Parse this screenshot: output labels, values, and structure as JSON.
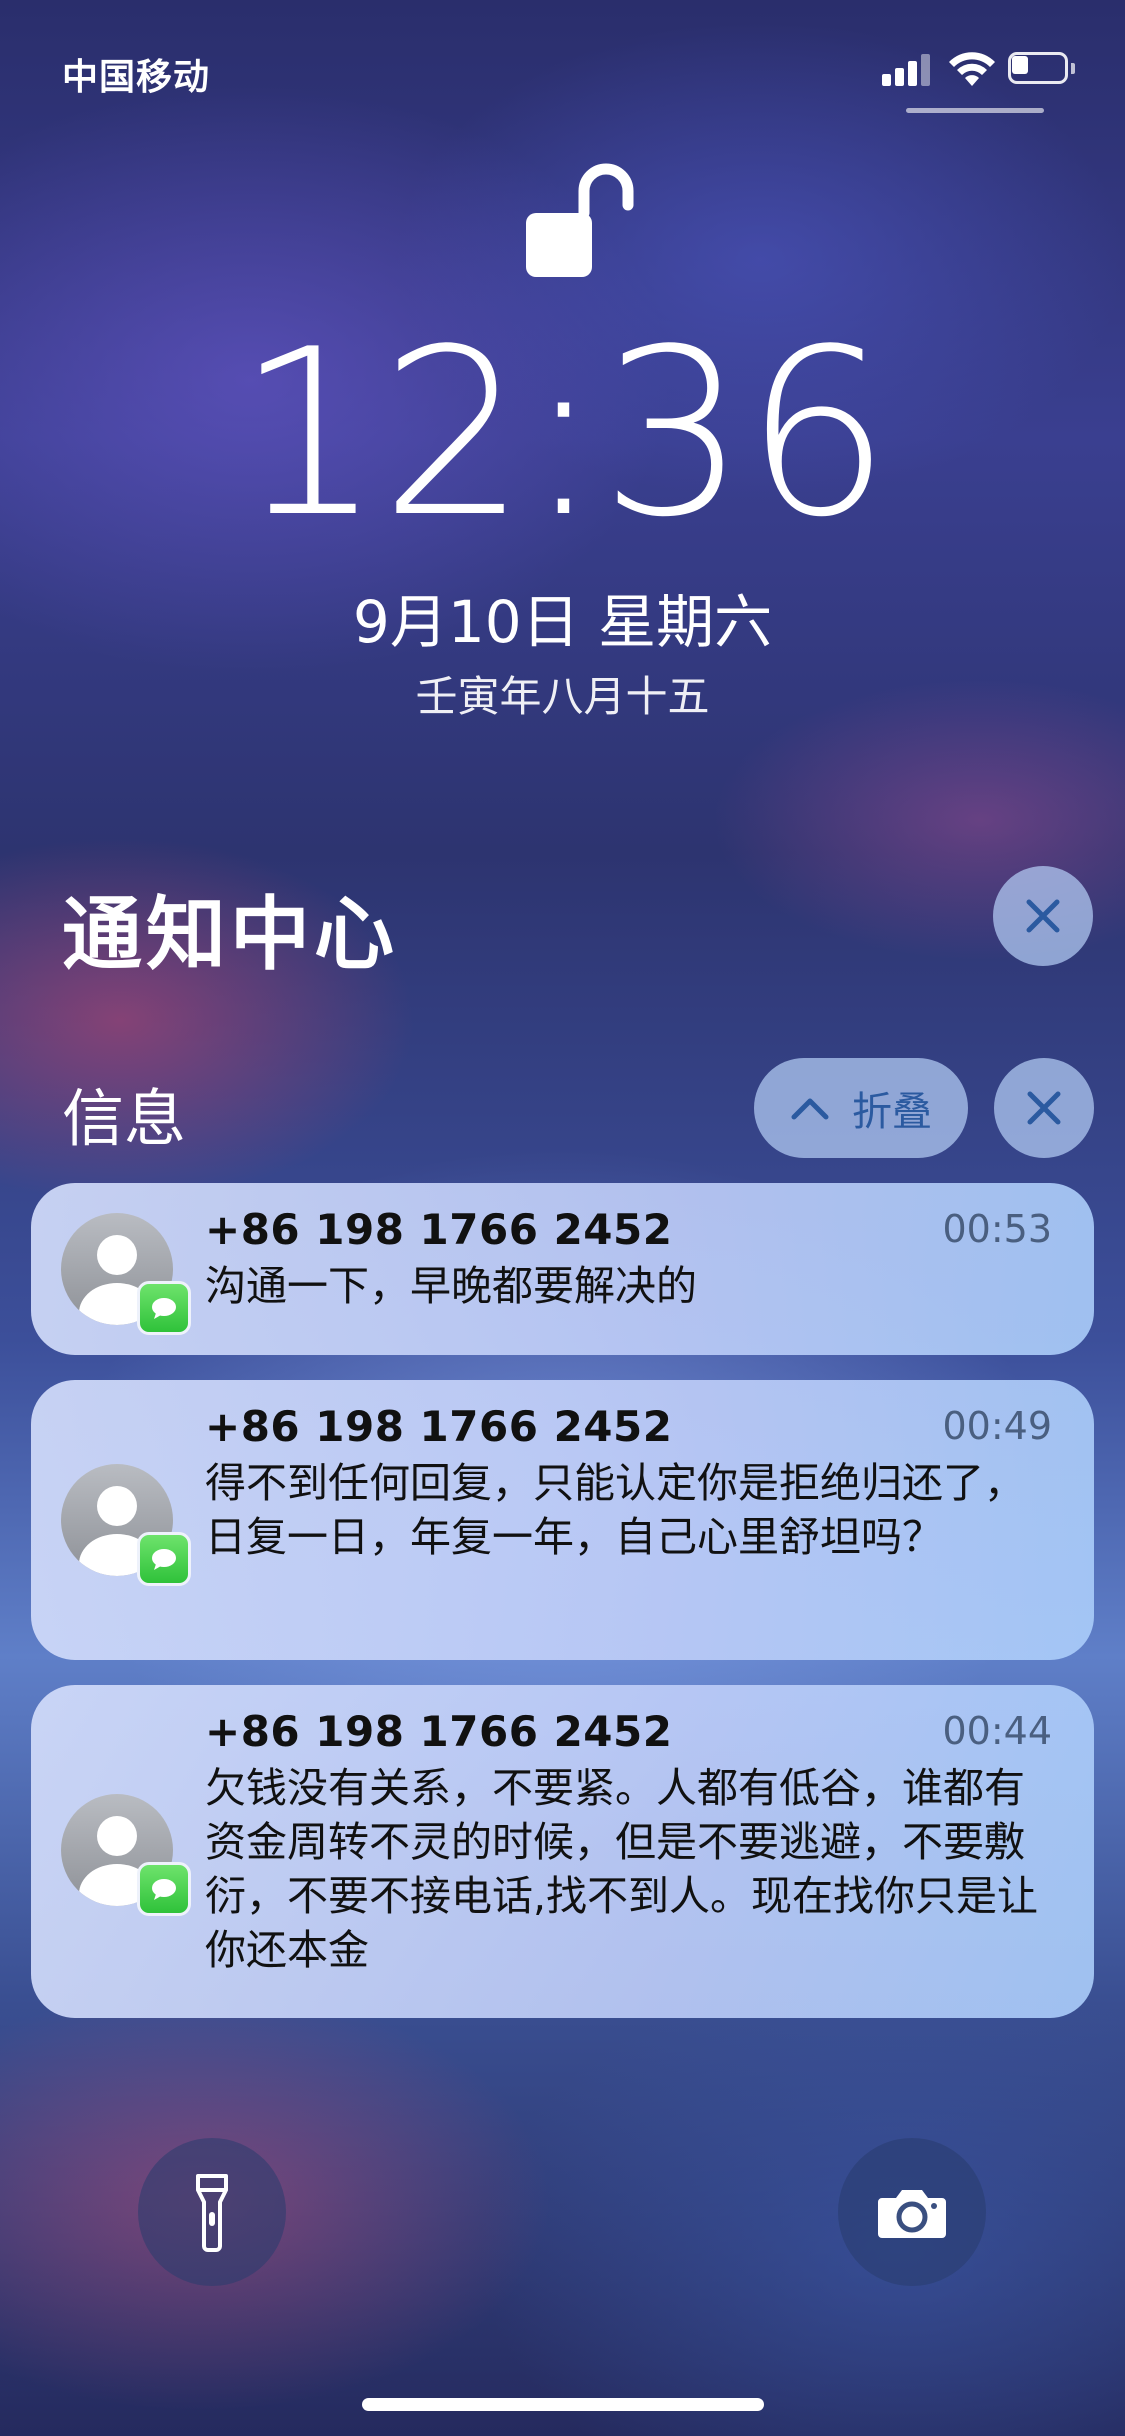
{
  "status_bar": {
    "carrier": "中国移动",
    "battery_level": 0.25
  },
  "lock": {
    "icon": "unlocked-padlock-icon"
  },
  "time": "12:36",
  "date": "9月10日 星期六",
  "lunar_date": "壬寅年八月十五",
  "notification_center": {
    "title": "通知中心"
  },
  "group": {
    "app_name": "信息",
    "collapse_label": "折叠"
  },
  "notifications": [
    {
      "sender": "+86 198 1766 2452",
      "time": "00:53",
      "body": "沟通一下，早晚都要解决的"
    },
    {
      "sender": "+86 198 1766 2452",
      "time": "00:49",
      "body": "得不到任何回复，只能认定你是拒绝归还了，日复一日，年复一年，自己心里舒坦吗？"
    },
    {
      "sender": "+86 198 1766 2452",
      "time": "00:44",
      "body": "欠钱没有关系，不要紧。人都有低谷，谁都有资金周转不灵的时候，但是不要逃避，不要敷衍，不要不接电话,找不到人。现在找你只是让你还本金"
    }
  ],
  "quick_actions": {
    "left": "flashlight-icon",
    "right": "camera-icon"
  },
  "colors": {
    "badge_green": "#34c759",
    "button_blue": "#2b5aa0"
  }
}
